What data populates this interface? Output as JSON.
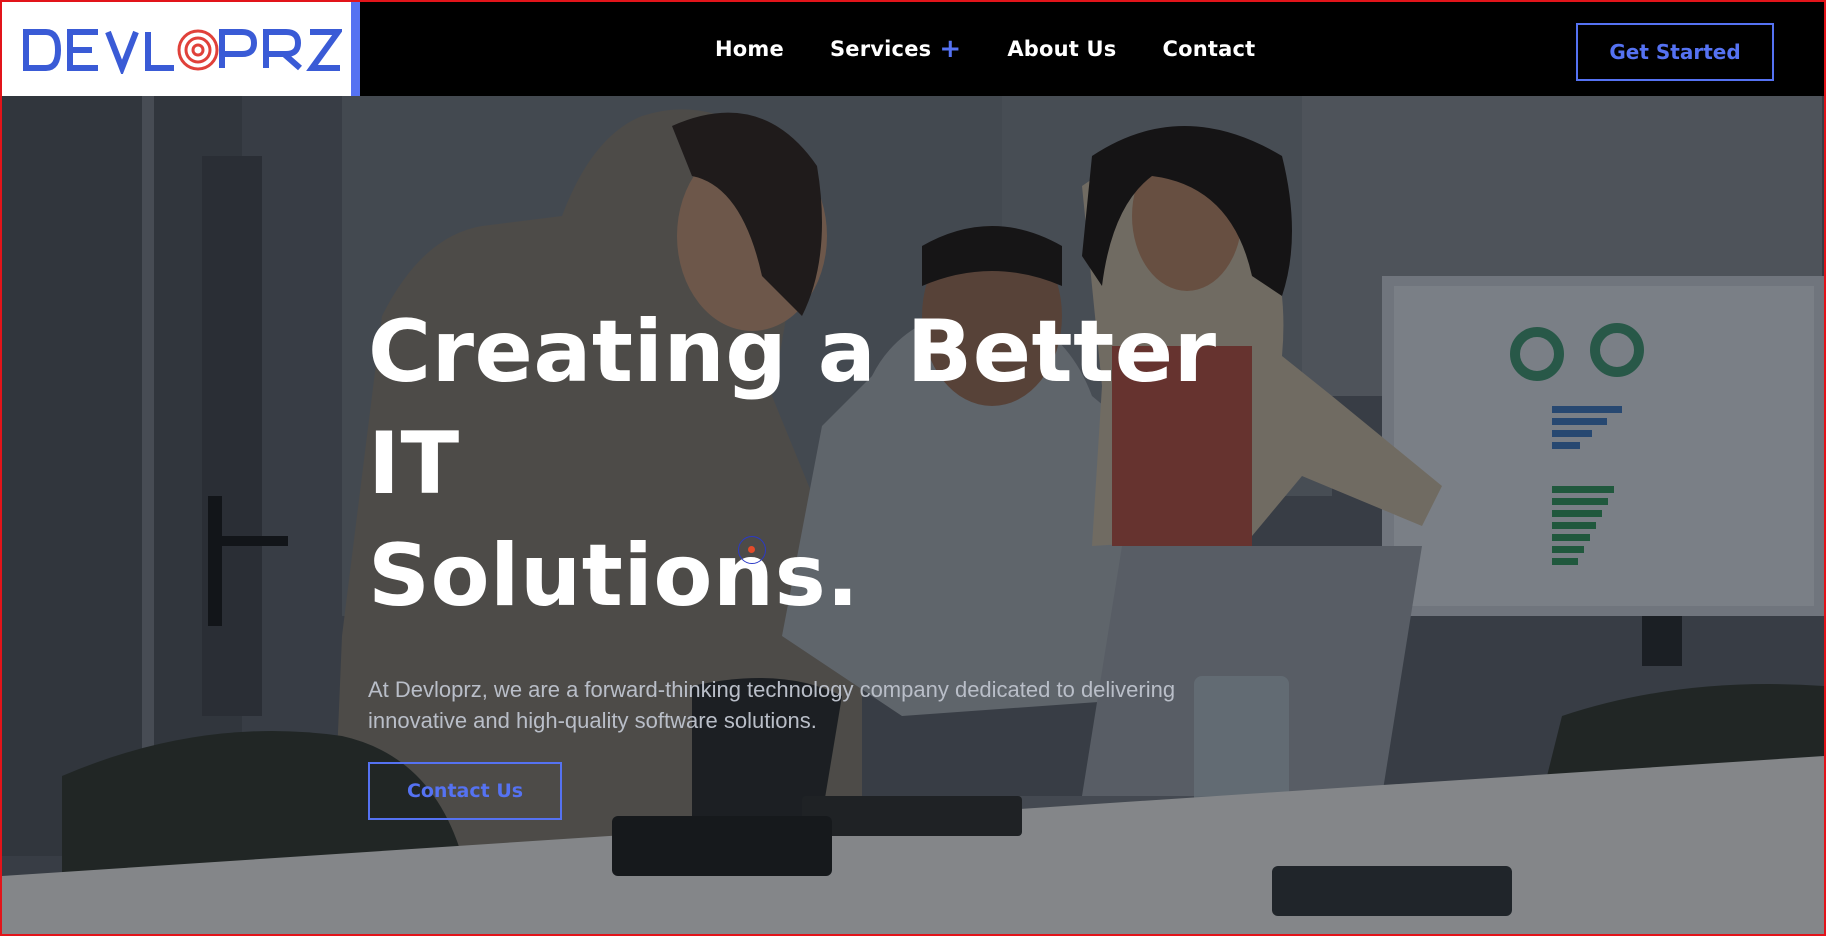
{
  "header": {
    "logo_text": "DEVLOPRZ",
    "nav": [
      {
        "label": "Home"
      },
      {
        "label": "Services",
        "icon": "plus-icon"
      },
      {
        "label": "About Us"
      },
      {
        "label": "Contact"
      }
    ],
    "cta_label": "Get Started"
  },
  "hero": {
    "title_line1": "Creating a Better IT",
    "title_line2": "Solutions.",
    "description": "At Devloprz, we are a forward-thinking technology company dedicated to delivering innovative and high-quality software solutions.",
    "button_label": "Contact Us"
  },
  "colors": {
    "accent": "#5572f2",
    "logo_red": "#e0413a",
    "nav_bg": "#000000",
    "frame_border": "#e2141a"
  }
}
